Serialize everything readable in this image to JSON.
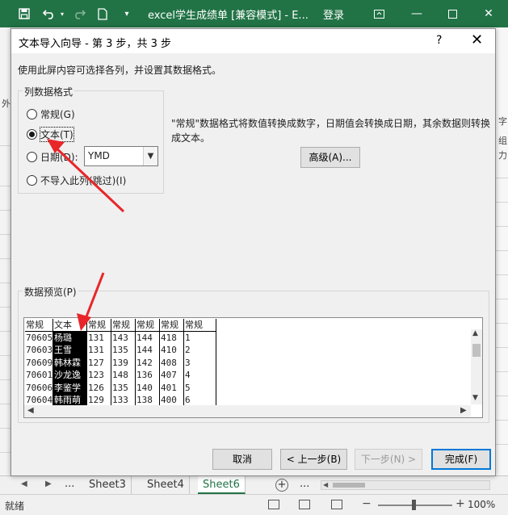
{
  "excel": {
    "doc_title": "excel学生成绩单  [兼容模式]  -  E...",
    "login_label": "登录",
    "quick_access_icons": [
      "save-icon",
      "undo-icon",
      "redo-icon",
      "new-file-icon",
      "customize-quick-access-icon"
    ],
    "window_controls": [
      "ribbon-display-icon",
      "minimize-icon",
      "maximize-icon",
      "close-icon"
    ],
    "left_edge_chars": [
      "外"
    ],
    "right_edge_chars": [
      "字",
      "组",
      "力"
    ],
    "sheet_tabs": [
      "Sheet3",
      "Sheet4",
      "Sheet6"
    ],
    "active_sheet": "Sheet6",
    "tab_overflow_label": "...",
    "tabs_more_label": "...",
    "status_text": "就绪",
    "zoom_label": "100%",
    "accent_color": "#217346"
  },
  "dialog": {
    "title": "文本导入向导 - 第 3 步，共 3 步",
    "help_label": "?",
    "close_label": "✕",
    "instruction": "使用此屏内容可选择各列，并设置其数据格式。",
    "column_format_group": {
      "legend": "列数据格式",
      "options": [
        {
          "label": "常规(G)",
          "selected": false
        },
        {
          "label": "文本(T)",
          "selected": true
        },
        {
          "label": "日期(D):",
          "selected": false
        },
        {
          "label": "不导入此列(跳过)(I)",
          "selected": false
        }
      ],
      "date_format_value": "YMD"
    },
    "description": "\"常规\"数据格式将数值转换成数字，日期值会转换成日期，其余数据则转换成文本。",
    "advanced_button": "高级(A)...",
    "preview": {
      "legend": "数据预览(P)",
      "headers": [
        "常规",
        "文本",
        "常规",
        "常规",
        "常规",
        "常规",
        "常规"
      ],
      "selected_column": 1,
      "rows": [
        [
          "70605",
          "杨璐",
          "131",
          "143",
          "144",
          "418",
          "1"
        ],
        [
          "70603",
          "王雪",
          "131",
          "135",
          "144",
          "410",
          "2"
        ],
        [
          "70609",
          "韩林霖",
          "127",
          "139",
          "142",
          "408",
          "3"
        ],
        [
          "70601",
          "沙龙逸",
          "123",
          "148",
          "136",
          "407",
          "4"
        ],
        [
          "70606",
          "李鉴学",
          "126",
          "135",
          "140",
          "401",
          "5"
        ],
        [
          "70604",
          "韩雨萌",
          "129",
          "133",
          "138",
          "400",
          "6"
        ]
      ]
    },
    "buttons": {
      "cancel": "取消",
      "back": "< 上一步(B)",
      "next": "下一步(N) >",
      "finish": "完成(F)"
    }
  },
  "annotations": {
    "arrow_color": "#e8262a"
  }
}
